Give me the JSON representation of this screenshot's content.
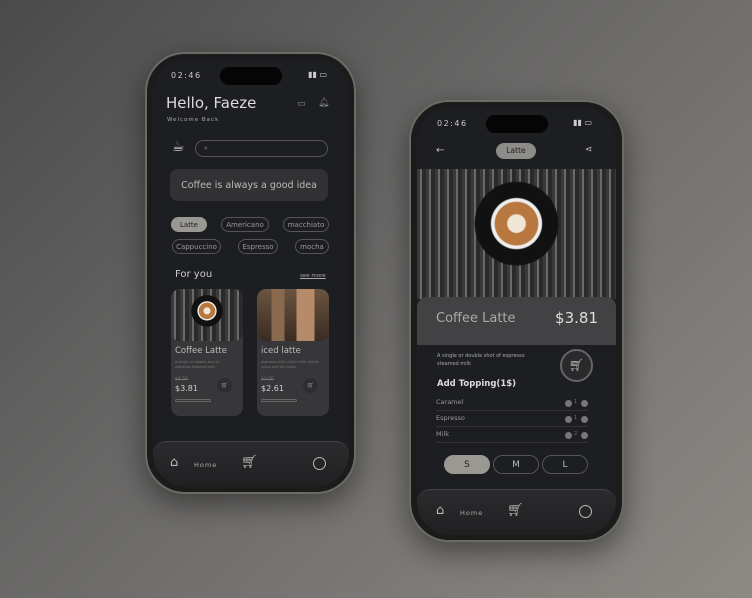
{
  "home": {
    "time": "02:46",
    "greeting": "Hello, Faeze",
    "subtitle": "Welcome Back",
    "search_placeholder": "",
    "banner": "Coffee is always a good idea",
    "chips": [
      "Latte",
      "Americano",
      "macchiato",
      "Cappuccino",
      "Espresso",
      "mocha"
    ],
    "section": "For you",
    "see_more": "see more",
    "cards": [
      {
        "name": "Coffee Latte",
        "desc": "a single or double shot of espresso steamed milk",
        "old_price": "$4.50",
        "price": "$3.81"
      },
      {
        "name": "iced latte",
        "desc": "espresso with chilled milk simple syrup and ice cubes",
        "old_price": "$3.50",
        "price": "$2.61"
      }
    ],
    "nav_home": "Home"
  },
  "detail": {
    "time": "02:46",
    "title": "Latte",
    "name": "Coffee Latte",
    "price": "$3.81",
    "desc": "A single or double shot of espresso steamed milk",
    "topping_title": "Add Topping(1$)",
    "toppings": [
      {
        "name": "Caramel",
        "qty": "1"
      },
      {
        "name": "Espresso",
        "qty": "1"
      },
      {
        "name": "Milk",
        "qty": "2"
      }
    ],
    "sizes": [
      "S",
      "M",
      "L"
    ],
    "selected_size": "S",
    "nav_home": "Home"
  },
  "colors": {
    "screen": "#1d1e21",
    "card": "#37373a",
    "accent": "#9a9893"
  }
}
